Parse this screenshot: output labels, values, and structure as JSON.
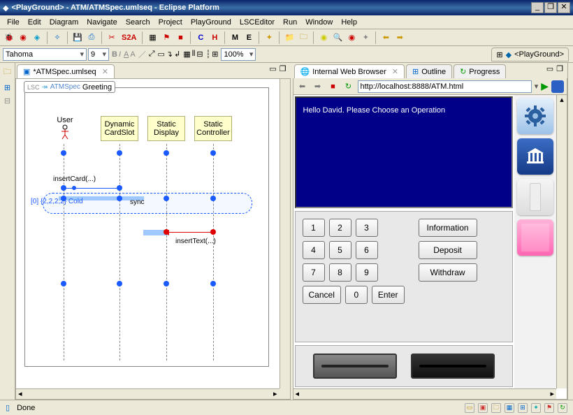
{
  "window": {
    "title": "<PlayGround> - ATM/ATMSpec.umlseq - Eclipse Platform",
    "minimize": "_",
    "restore": "❐",
    "close": "✕"
  },
  "menu": {
    "items": [
      "File",
      "Edit",
      "Diagram",
      "Navigate",
      "Search",
      "Project",
      "PlayGround",
      "LSCEditor",
      "Run",
      "Window",
      "Help"
    ]
  },
  "toolbar1": {
    "s2a_label": "S2A",
    "c_label": "C",
    "h_label": "H",
    "m_label": "M",
    "e_label": "E"
  },
  "toolbar2": {
    "font": "Tahoma",
    "size": "9",
    "zoom": "100%",
    "bold": "B",
    "italic": "I",
    "a1": "A",
    "a2": "A"
  },
  "perspective": {
    "label": "<PlayGround>"
  },
  "editor_tab": {
    "label": "*ATMSpec.umlseq",
    "close": "✕"
  },
  "diagram": {
    "lsc": "LSC",
    "spec": "ATMSpec",
    "name": "Greeting",
    "user": "User",
    "lifelines": [
      {
        "l1": "Dynamic",
        "l2": "CardSlot"
      },
      {
        "l1": "Static",
        "l2": "Display"
      },
      {
        "l1": "Static",
        "l2": "Controller"
      }
    ],
    "msg_insertCard": "insertCard(...)",
    "sync": "sync",
    "cold": "[0] {2,2,2,2} Cold",
    "msg_insertText": "insertText(...)"
  },
  "rtabs": {
    "browser": "Internal Web Browser",
    "outline": "Outline",
    "progress": "Progress"
  },
  "address": {
    "url": "http://localhost:8888/ATM.html"
  },
  "atm": {
    "screen_text": "Hello David. Please Choose an Operation",
    "keys": {
      "k1": "1",
      "k2": "2",
      "k3": "3",
      "k4": "4",
      "k5": "5",
      "k6": "6",
      "k7": "7",
      "k8": "8",
      "k9": "9",
      "k0": "0"
    },
    "cancel": "Cancel",
    "enter": "Enter",
    "ops": {
      "info": "Information",
      "deposit": "Deposit",
      "withdraw": "Withdraw"
    }
  },
  "status": {
    "text": "Done"
  }
}
